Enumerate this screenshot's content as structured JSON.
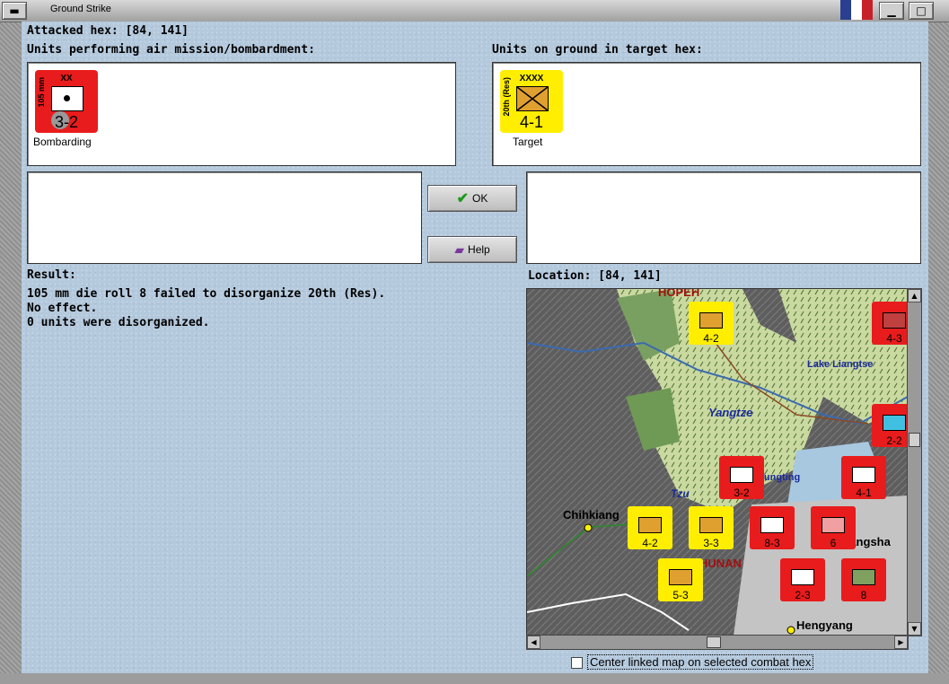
{
  "window": {
    "title": "Ground Strike"
  },
  "attacked_hex": "Attacked hex:  [84, 141]",
  "air_units": {
    "label": "Units performing air mission/bombardment:",
    "units": [
      {
        "size": "XX",
        "side_label": "105 mm",
        "value": "3-2",
        "caption": "Bombarding",
        "color": "#e81c1c"
      }
    ]
  },
  "ground_units": {
    "label": "Units on ground in target hex:",
    "units": [
      {
        "size": "XXXX",
        "side_label": "20th (Res)",
        "value": "4-1",
        "caption": "Target",
        "color": "#ffee00"
      }
    ]
  },
  "buttons": {
    "ok": "OK",
    "help": "Help"
  },
  "result": {
    "label": "Result:",
    "lines": [
      "105 mm die roll 8 failed to disorganize 20th (Res).",
      "No effect.",
      "0 units were disorganized."
    ]
  },
  "location": "Location:  [84, 141]",
  "map": {
    "place_names": [
      "HOPEH",
      "Lake Liangtse",
      "Yangtze",
      "Tungting",
      "Tzu",
      "Chihkiang",
      "HUNAN",
      "Changsha",
      "Hengyang"
    ],
    "counters": [
      "4-2",
      "4-3",
      "2-2",
      "3-2",
      "4-1",
      "4-2",
      "3-3",
      "8-3",
      "6",
      "5-3",
      "2-3",
      "8"
    ]
  },
  "center_linked_map": {
    "label": "Center linked map on selected combat hex",
    "checked": false
  }
}
